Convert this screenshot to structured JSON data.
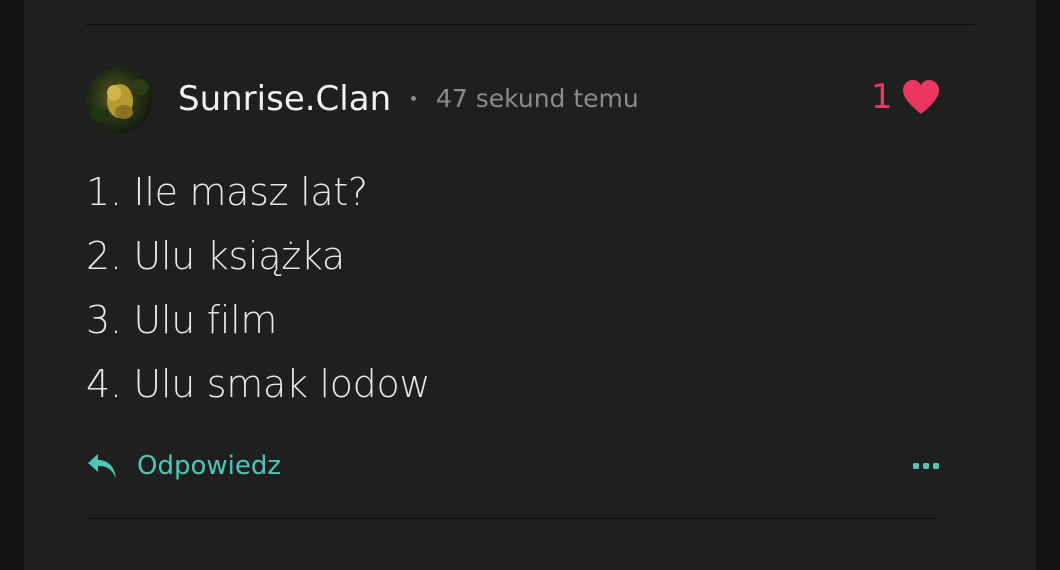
{
  "comment": {
    "author": "Sunrise.Clan",
    "timestamp": "47 sekund temu",
    "likes": "1",
    "lines": [
      "1. Ile masz lat?",
      "2. Ulu książka",
      "3. Ulu film",
      "4. Ulu smak lodow"
    ],
    "reply_label": "Odpowiedz"
  },
  "colors": {
    "accent": "#4fc6b5",
    "like": "#e9375f",
    "card_background": "#1f1f1f"
  },
  "icons": {
    "like": "heart-icon",
    "reply": "reply-arrow-icon",
    "more": "more-options-icon"
  }
}
